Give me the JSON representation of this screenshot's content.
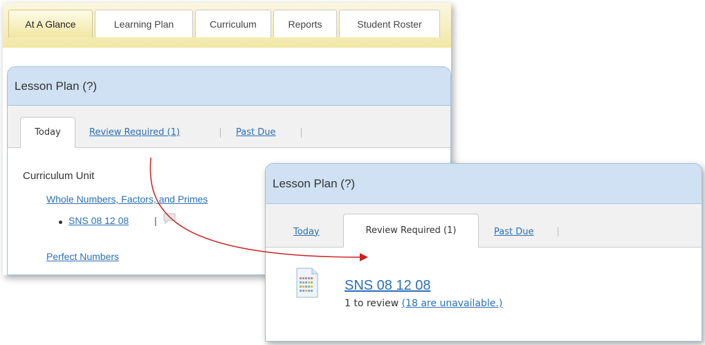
{
  "top_tabs": [
    "At A Glance",
    "Learning Plan",
    "Curriculum",
    "Reports",
    "Student Roster"
  ],
  "back_panel": {
    "title": "Lesson Plan (?)",
    "tabs": [
      "Today",
      "Review Required (1)",
      "Past Due"
    ],
    "section_label": "Curriculum Unit",
    "unit_link": "Whole Numbers, Factors, and Primes",
    "item_link": "SNS 08 12 08",
    "item_separator": "|",
    "unit_link_2": "Perfect Numbers"
  },
  "front_panel": {
    "title": "Lesson Plan (?)",
    "tabs": [
      "Today",
      "Review Required (1)",
      "Past Due"
    ],
    "doc_title": "SNS 08 12 08",
    "review_count": "1 to review",
    "unavailable": "(18 are unavailable.)"
  },
  "colors": {
    "panel_header": "#cfe1f2",
    "nav_yellow": "#f1e8a6",
    "link": "#2a6fb8",
    "arrow": "#cc1f1f"
  },
  "icons": [
    "document-icon",
    "speech-bubble-icon",
    "arrow-icon"
  ]
}
